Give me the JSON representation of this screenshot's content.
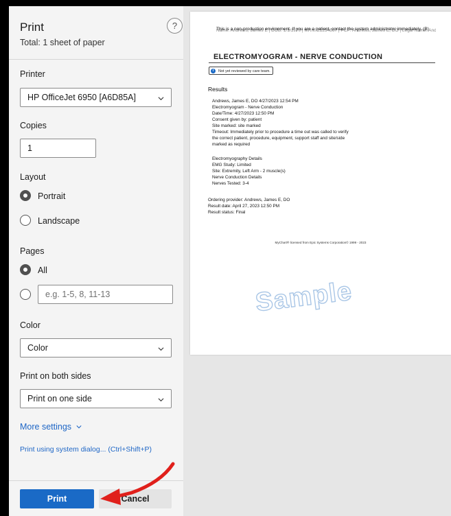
{
  "dialog": {
    "title": "Print",
    "subtitle": "Total: 1 sheet of paper",
    "help_label": "?"
  },
  "printer": {
    "label": "Printer",
    "selected": "HP OfficeJet 6950 [A6D85A]",
    "icon": "chevron-down-icon"
  },
  "copies": {
    "label": "Copies",
    "value": "1"
  },
  "layout": {
    "label": "Layout",
    "options": [
      {
        "label": "Portrait",
        "checked": true
      },
      {
        "label": "Landscape",
        "checked": false
      }
    ]
  },
  "pages": {
    "label": "Pages",
    "all_label": "All",
    "custom_placeholder": "e.g. 1-5, 8, 11-13"
  },
  "color": {
    "label": "Color",
    "selected": "Color"
  },
  "duplex": {
    "label": "Print on both sides",
    "selected": "Print on one side"
  },
  "links": {
    "more_settings": "More settings",
    "system_dialog": "Print using system dialog... (Ctrl+Shift+P)"
  },
  "buttons": {
    "print": "Print",
    "cancel": "Cancel"
  },
  "preview": {
    "banner": "This is a non-production environment. If you are a patient, contact the system administrator immediately. (B)",
    "banner2": "Name: Andrews, James E | DOB: 1/1/1970 | MRN: Z1234567 | PCP: Andrews, James E, DO | Legal Name: Andrews, James E, Epic",
    "doc_title": "ELECTROMYOGRAM - NERVE CONDUCTION",
    "review_badge": "Not yet reviewed by care team.",
    "results_heading": "Results",
    "lines_a": [
      "Andrews, James E, DO 4/27/2023 12:54 PM",
      "Electromyogram - Nerve Conduction",
      "Date/Time: 4/27/2023 12:50 PM",
      "Consent given by: patient",
      "Site marked: site marked",
      "Timeout: Immediately prior to procedure a time out was called to verify",
      "the correct patient, procedure, equipment, support staff and site/side",
      "marked as required"
    ],
    "lines_b": [
      "Electromyography Details",
      "EMG Study: Limited",
      "Site: Extremity, Left Arm - 2 muscle(s)",
      "Nerve Conduction Details",
      "Nerves Tested: 3-4"
    ],
    "lines_c": [
      "Ordering provider: Andrews, James E, DO",
      "Result date: April 27, 2023 12:50 PM",
      "Result status: Final"
    ],
    "footer": "MyChart® licensed from Epic Systems Corporation© 1999 - 2023",
    "watermark": "Sample"
  },
  "colors": {
    "accent": "#1a6ac6",
    "panel_bg": "#f4f4f4",
    "preview_bg": "#e6e6e6",
    "annotation_arrow": "#e0201b"
  }
}
